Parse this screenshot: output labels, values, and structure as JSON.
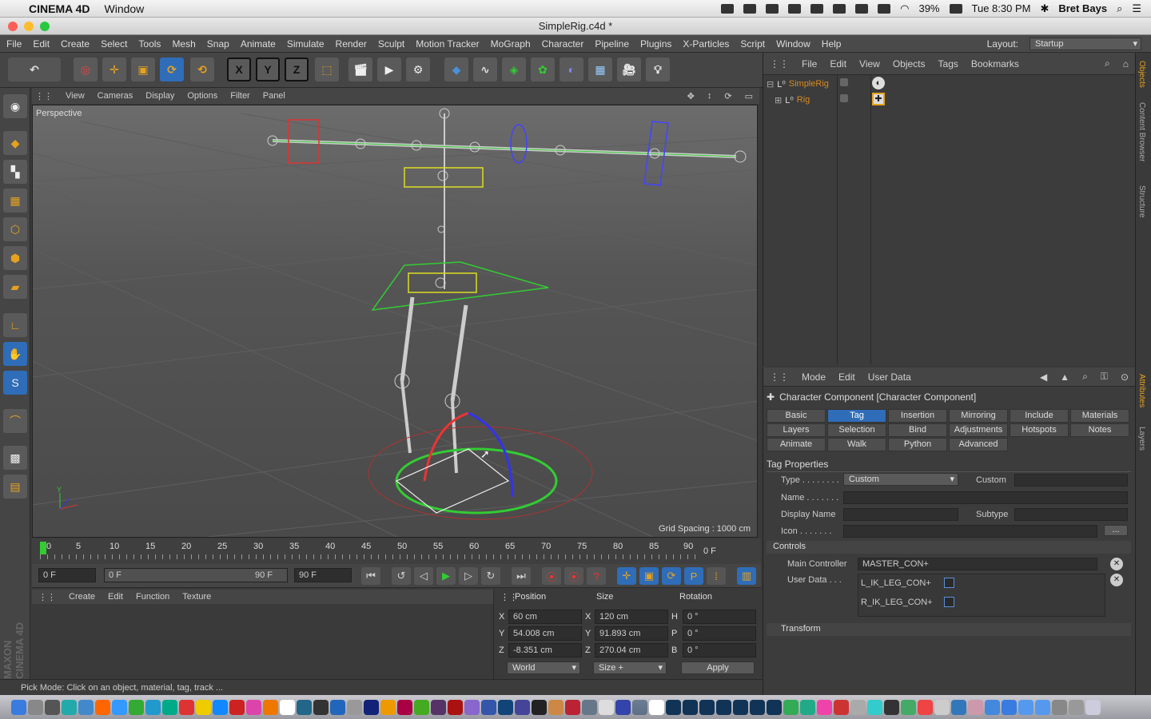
{
  "mac": {
    "apple": "",
    "app": "CINEMA 4D",
    "menu": [
      "Window"
    ],
    "battery": "39%",
    "clock": "Tue 8:30 PM",
    "user": "Bret Bays"
  },
  "window": {
    "title": "SimpleRig.c4d *"
  },
  "menu": [
    "File",
    "Edit",
    "Create",
    "Select",
    "Tools",
    "Mesh",
    "Snap",
    "Animate",
    "Simulate",
    "Render",
    "Sculpt",
    "Motion Tracker",
    "MoGraph",
    "Character",
    "Pipeline",
    "Plugins",
    "X-Particles",
    "Script",
    "Window",
    "Help"
  ],
  "layout": {
    "label": "Layout:",
    "value": "Startup"
  },
  "toolbar": {
    "x": "X",
    "y": "Y",
    "z": "Z"
  },
  "viewport": {
    "menu": [
      "View",
      "Cameras",
      "Display",
      "Options",
      "Filter",
      "Panel"
    ],
    "camera": "Perspective",
    "grid": "Grid Spacing : 1000 cm",
    "axis_y": "Y"
  },
  "timeline": {
    "ticks": [
      "0",
      "5",
      "10",
      "15",
      "20",
      "25",
      "30",
      "35",
      "40",
      "45",
      "50",
      "55",
      "60",
      "65",
      "70",
      "75",
      "80",
      "85",
      "90"
    ],
    "current": "0 F",
    "start": "0 F",
    "range_start": "0 F",
    "range_end": "90 F",
    "end": "90 F"
  },
  "material": {
    "menu": [
      "Create",
      "Edit",
      "Function",
      "Texture"
    ]
  },
  "coords": {
    "headers": {
      "position": "Position",
      "size": "Size",
      "rotation": "Rotation"
    },
    "rows": [
      {
        "axis": "X",
        "pos": "60 cm",
        "saxis": "X",
        "size": "120 cm",
        "raxis": "H",
        "rot": "0 °"
      },
      {
        "axis": "Y",
        "pos": "54.008 cm",
        "saxis": "Y",
        "size": "91.893 cm",
        "raxis": "P",
        "rot": "0 °"
      },
      {
        "axis": "Z",
        "pos": "-8.351 cm",
        "saxis": "Z",
        "size": "270.04 cm",
        "raxis": "B",
        "rot": "0 °"
      }
    ],
    "space": "World",
    "size_mode": "Size +",
    "apply": "Apply"
  },
  "status": "Pick Mode: Click on an object, material, tag, track ...",
  "maxon": "MAXON CINEMA 4D",
  "objects": {
    "menu": [
      "File",
      "Edit",
      "View",
      "Objects",
      "Tags",
      "Bookmarks"
    ],
    "items": [
      {
        "name": "SimpleRig"
      },
      {
        "name": "Rig"
      }
    ]
  },
  "attributes": {
    "menu": [
      "Mode",
      "Edit",
      "User Data"
    ],
    "heading": "Character Component [Character Component]",
    "tabs": [
      [
        "Basic",
        "Tag",
        "Insertion",
        "Mirroring",
        "Include",
        "Materials"
      ],
      [
        "Layers",
        "Selection",
        "Bind",
        "Adjustments",
        "Hotspots",
        "Notes"
      ],
      [
        "Animate",
        "Walk",
        "Python",
        "Advanced"
      ]
    ],
    "section_tag": "Tag Properties",
    "type_label": "Type . . . . . . . .",
    "type_value": "Custom",
    "custom_label": "Custom",
    "name_label": "Name . . . . . . .",
    "display_label": "Display Name",
    "subtype_label": "Subtype",
    "icon_label": "Icon . . . . . . .",
    "icon_btn": "...",
    "controls": "Controls",
    "main_ctrl_label": "Main Controller",
    "main_ctrl_value": "MASTER_CON+",
    "userdata_label": "User Data . . .",
    "ud1": "L_IK_LEG_CON+",
    "ud2": "R_IK_LEG_CON+",
    "transform": "Transform"
  },
  "side_tabs": [
    "Objects",
    "Content Browser",
    "Structure",
    "Attributes",
    "Layers"
  ]
}
